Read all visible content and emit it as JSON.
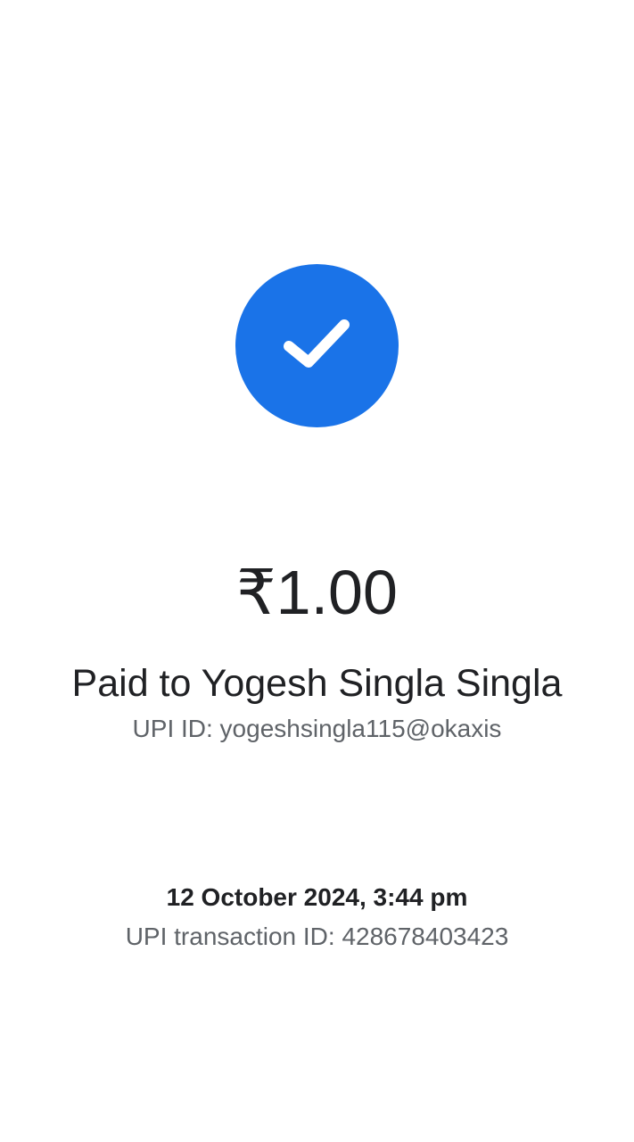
{
  "colors": {
    "accent": "#1a73e8",
    "check": "#ffffff",
    "text_primary": "#202124",
    "text_secondary": "#5f6368",
    "background": "#ffffff"
  },
  "status": {
    "icon": "check-icon"
  },
  "payment": {
    "amount": "₹1.00",
    "paid_to": "Paid to Yogesh Singla Singla",
    "upi_id": "UPI ID: yogeshsingla115@okaxis",
    "datetime": "12 October 2024, 3:44 pm",
    "transaction_id": "UPI transaction ID: 428678403423"
  }
}
